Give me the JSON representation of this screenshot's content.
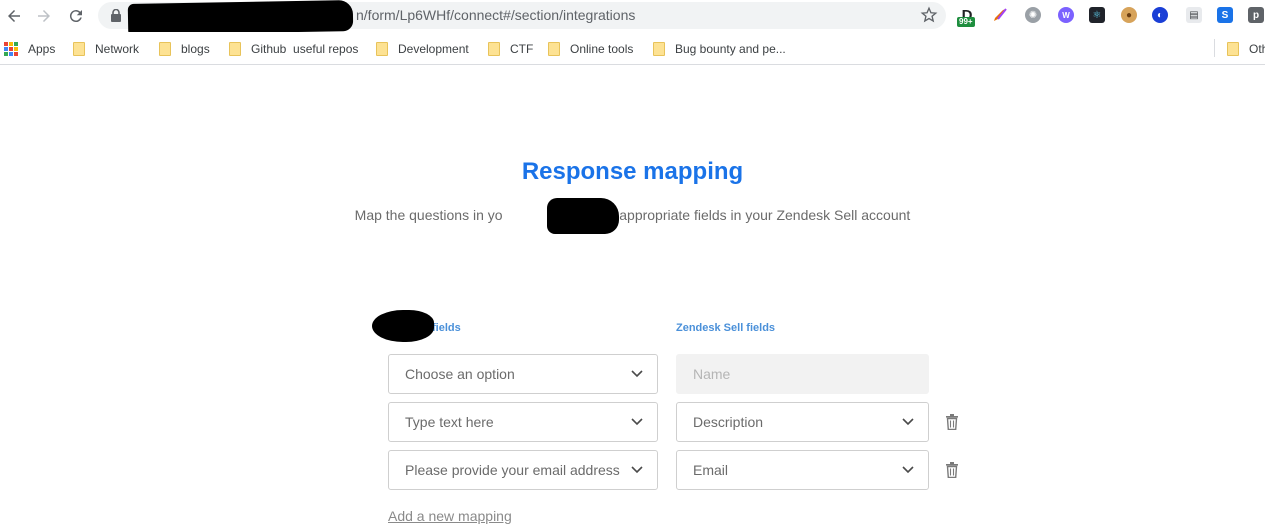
{
  "browser": {
    "url_visible": "n/form/Lp6WHf/connect#/section/integrations",
    "ext_badge": "99+",
    "bookmarks": [
      {
        "label": "Apps"
      },
      {
        "label": "Network"
      },
      {
        "label": "blogs"
      },
      {
        "label": "Github  useful repos"
      },
      {
        "label": "Development"
      },
      {
        "label": "CTF"
      },
      {
        "label": "Online tools"
      },
      {
        "label": "Bug bounty and pe..."
      },
      {
        "label": "Oth"
      }
    ]
  },
  "page": {
    "title": "Response mapping",
    "subtitle": "Map the questions in yo                    to the appropriate fields in your Zendesk Sell account",
    "left_column_label": "T         n fields",
    "right_column_label": "Zendesk Sell fields",
    "rows": [
      {
        "left": "Choose an option",
        "right_placeholder": "Name"
      },
      {
        "left": "Type text here",
        "right": "Description"
      },
      {
        "left": "Please provide your email address",
        "right": "Email"
      }
    ],
    "add_link": "Add a new mapping"
  },
  "colors": {
    "accent": "#1a73e8",
    "label": "#4a90d9"
  }
}
